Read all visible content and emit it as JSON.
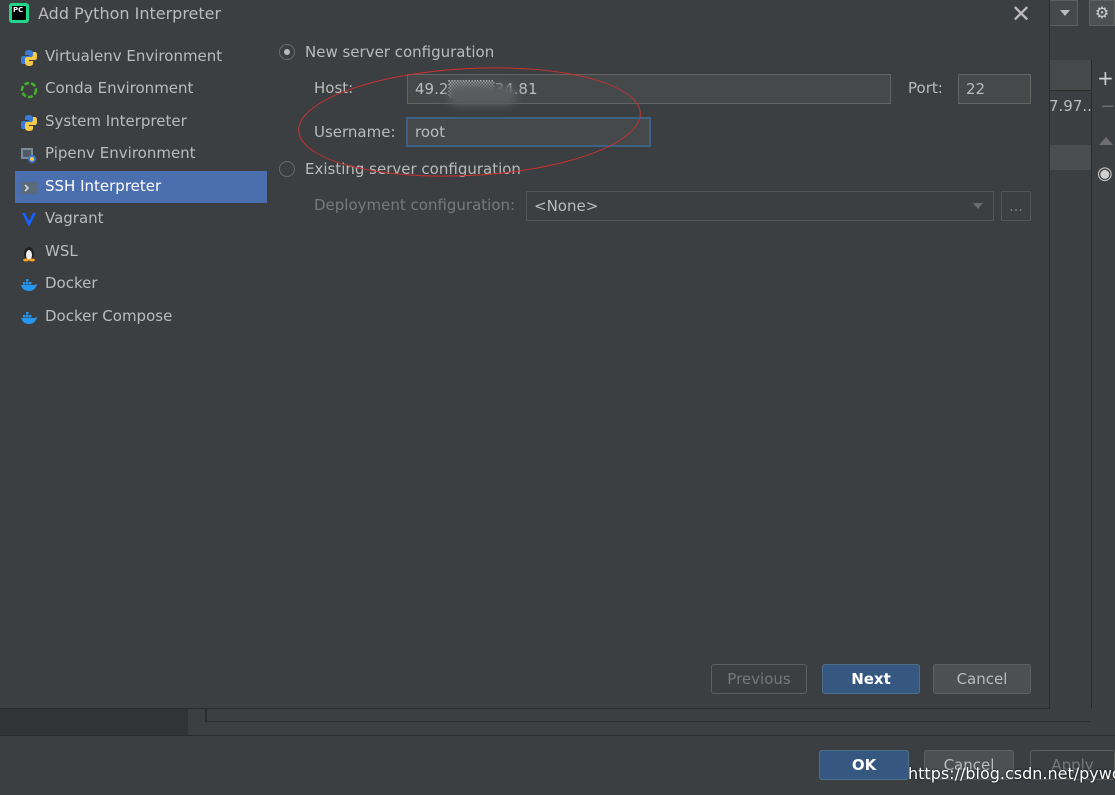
{
  "dialog": {
    "title": "Add Python Interpreter",
    "app_icon_text": "PC",
    "close_icon": "close-icon"
  },
  "nav": {
    "items": [
      {
        "label": "Virtualenv Environment",
        "icon": "python-icon",
        "selected": false
      },
      {
        "label": "Conda Environment",
        "icon": "conda-icon",
        "selected": false
      },
      {
        "label": "System Interpreter",
        "icon": "python-icon",
        "selected": false
      },
      {
        "label": "Pipenv Environment",
        "icon": "pipenv-icon",
        "selected": false
      },
      {
        "label": "SSH Interpreter",
        "icon": "ssh-icon",
        "selected": true
      },
      {
        "label": "Vagrant",
        "icon": "vagrant-icon",
        "selected": false
      },
      {
        "label": "WSL",
        "icon": "linux-icon",
        "selected": false
      },
      {
        "label": "Docker",
        "icon": "docker-icon",
        "selected": false
      },
      {
        "label": "Docker Compose",
        "icon": "docker-icon",
        "selected": false
      }
    ]
  },
  "form": {
    "new_server_label": "New server configuration",
    "new_server_selected": true,
    "host_label": "Host:",
    "host_value": "49.2▒▒▒▒34.81",
    "port_label": "Port:",
    "port_value": "22",
    "username_label": "Username:",
    "username_value": "root",
    "existing_server_label": "Existing server configuration",
    "existing_server_selected": false,
    "deployment_label": "Deployment configuration:",
    "deployment_value": "<None>",
    "browse_label": "..."
  },
  "buttons": {
    "previous": "Previous",
    "next": "Next",
    "cancel": "Cancel"
  },
  "background_window": {
    "cell_text": "7.97...",
    "ok": "OK",
    "cancel": "Cancel",
    "apply": "Apply",
    "gear_icon": "⚙"
  },
  "watermark": "https://blog.csdn.net/pyword",
  "colors": {
    "accent": "#4b6eaf",
    "primary_button": "#365880",
    "annotation": "#d03030"
  }
}
